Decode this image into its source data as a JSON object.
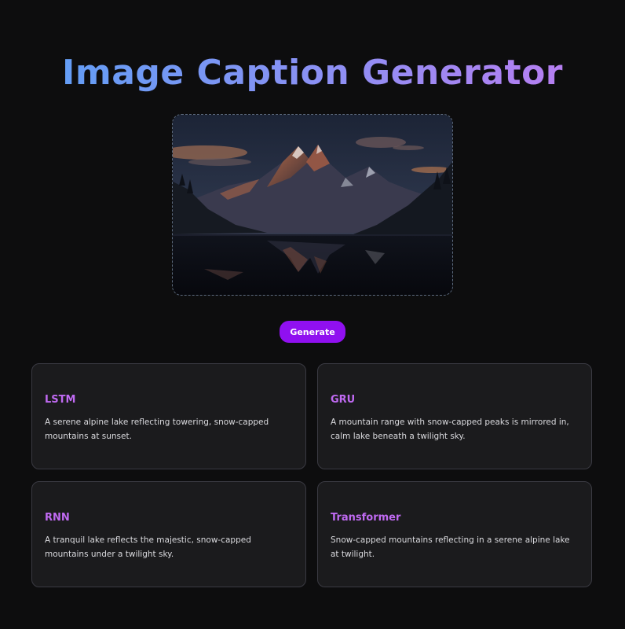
{
  "header": {
    "title": "Image Caption Generator"
  },
  "upload": {
    "image_description_icon": "mountain-lake-image"
  },
  "actions": {
    "generate_label": "Generate"
  },
  "results": [
    {
      "model": "LSTM",
      "caption": "A serene alpine lake reflecting towering, snow-capped mountains at sunset."
    },
    {
      "model": "GRU",
      "caption": "A mountain range with snow-capped peaks is mirrored in, calm lake beneath a twilight sky."
    },
    {
      "model": "RNN",
      "caption": "A tranquil lake reflects the majestic, snow-capped mountains under a twilight sky."
    },
    {
      "model": "Transformer",
      "caption": "Snow-capped mountains reflecting in a serene alpine lake at twilight."
    }
  ],
  "colors": {
    "background": "#0d0d0e",
    "accent": "#9010f0",
    "card_title": "#c06af2",
    "title_gradient_start": "#5aa0f5",
    "title_gradient_end": "#c07af0"
  }
}
